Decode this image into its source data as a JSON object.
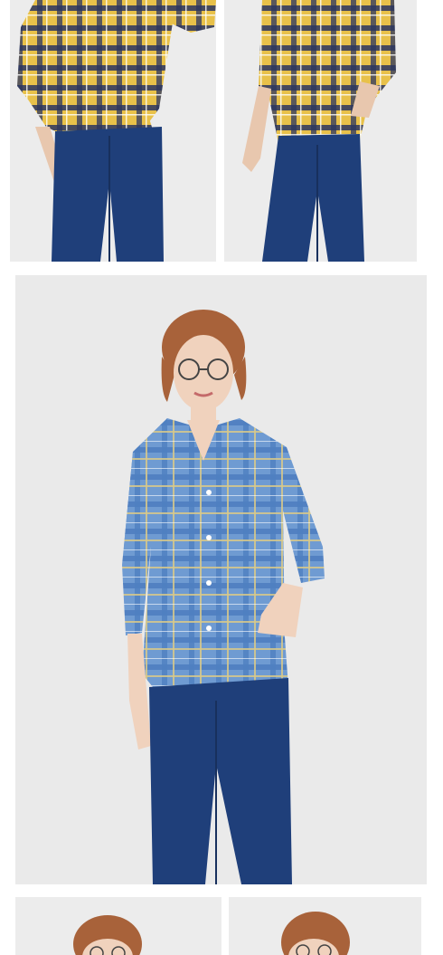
{
  "gallery": {
    "images": [
      {
        "name": "yellow-plaid-shirt-tied-front",
        "shirt_color": "#e8c14a",
        "pattern_color": "#2a3560"
      },
      {
        "name": "yellow-plaid-shirt-hand-in-pocket",
        "shirt_color": "#e8c14a",
        "pattern_color": "#2a3560"
      },
      {
        "name": "blue-plaid-shirt-full-length",
        "shirt_color": "#6f9bd2",
        "pattern_color": "#d8c98a"
      },
      {
        "name": "model-portrait-left",
        "hair_color": "#a8623a"
      },
      {
        "name": "model-portrait-right",
        "hair_color": "#a8623a"
      }
    ],
    "jeans_color": "#1f3f7a",
    "background_color": "#ececec"
  }
}
